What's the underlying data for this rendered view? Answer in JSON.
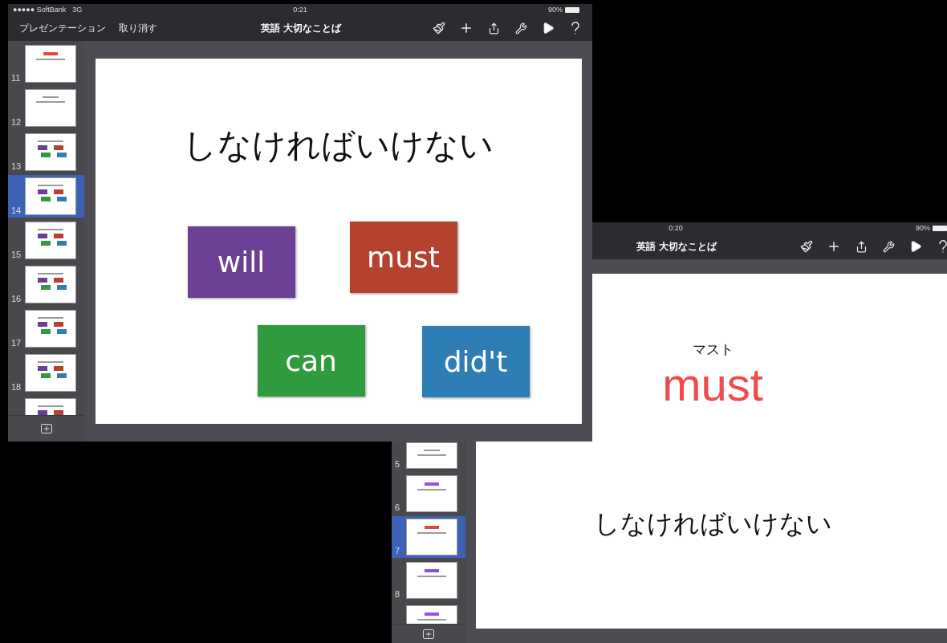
{
  "windows": [
    {
      "status_bar": {
        "carrier": "●●●●● SoftBank",
        "network": "3G",
        "time": "0:21",
        "battery": "90%"
      },
      "toolbar": {
        "left_buttons": [
          "プレゼンテーション",
          "取り消す"
        ],
        "title": "英語 大切なことば"
      },
      "slide_list": [
        {
          "number": "11",
          "selected": false,
          "kind": "word",
          "color": "#e0483f"
        },
        {
          "number": "12",
          "selected": false,
          "kind": "text"
        },
        {
          "number": "13",
          "selected": false,
          "kind": "tiles",
          "tiles": [
            {
              "color": "#6b3f93"
            },
            {
              "color": "#b5412f"
            },
            {
              "color": "#2f9a3e"
            },
            {
              "color": "#2e7db5"
            }
          ]
        },
        {
          "number": "14",
          "selected": true,
          "kind": "tiles",
          "tiles": [
            {
              "color": "#6b3f93"
            },
            {
              "color": "#b5412f"
            },
            {
              "color": "#2f9a3e"
            },
            {
              "color": "#2e7db5"
            }
          ]
        },
        {
          "number": "15",
          "selected": false,
          "kind": "tiles",
          "tiles": [
            {
              "color": "#6b3f93"
            },
            {
              "color": "#b5412f"
            },
            {
              "color": "#2f9a3e"
            },
            {
              "color": "#2e7db5"
            }
          ]
        },
        {
          "number": "16",
          "selected": false,
          "kind": "tiles",
          "tiles": [
            {
              "color": "#6b3f93"
            },
            {
              "color": "#b5412f"
            },
            {
              "color": "#2f9a3e"
            },
            {
              "color": "#2e7db5"
            }
          ]
        },
        {
          "number": "17",
          "selected": false,
          "kind": "tiles",
          "tiles": [
            {
              "color": "#6b3f93"
            },
            {
              "color": "#b5412f"
            },
            {
              "color": "#2f9a3e"
            },
            {
              "color": "#2e7db5"
            }
          ]
        },
        {
          "number": "18",
          "selected": false,
          "kind": "tiles",
          "tiles": [
            {
              "color": "#6b3f93"
            },
            {
              "color": "#b5412f"
            },
            {
              "color": "#2f9a3e"
            },
            {
              "color": "#2e7db5"
            }
          ]
        },
        {
          "selected": false,
          "kind": "tiles",
          "tiles": [
            {
              "color": "#6b3f93"
            },
            {
              "color": "#b5412f"
            }
          ]
        }
      ],
      "slide": {
        "kind": "tiles",
        "title": "しなければいけない",
        "tiles": [
          {
            "label": "will",
            "color": "#6b3f93"
          },
          {
            "label": "must",
            "color": "#b5412f"
          },
          {
            "label": "can",
            "color": "#2f9a3e"
          },
          {
            "label": "did't",
            "color": "#2e7db5"
          }
        ]
      }
    },
    {
      "status_bar": {
        "time": "0:20",
        "battery": "90%"
      },
      "toolbar": {
        "title": "英語 大切なことば"
      },
      "slide_list": [
        {
          "number": "5",
          "selected": false,
          "kind": "text"
        },
        {
          "number": "6",
          "selected": false,
          "kind": "word",
          "color": "#9b4fe0"
        },
        {
          "number": "7",
          "selected": true,
          "kind": "word",
          "color": "#e0483f"
        },
        {
          "number": "8",
          "selected": false,
          "kind": "word",
          "color": "#8a4fd8"
        },
        {
          "selected": false,
          "kind": "word",
          "color": "#9b4fe0"
        }
      ],
      "slide": {
        "kind": "word",
        "reading": "マスト",
        "word": "must",
        "color": "#f04a4a",
        "meaning": "しなければいけない"
      }
    }
  ]
}
